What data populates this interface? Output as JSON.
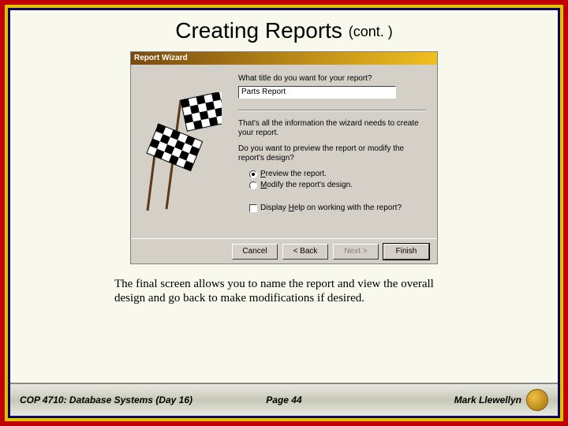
{
  "slide": {
    "title_main": "Creating Reports",
    "title_suffix": "(cont. )"
  },
  "wizard": {
    "titlebar": "Report Wizard",
    "q_title": "What title do you want for your report?",
    "title_value": "Parts Report",
    "info1": "That's all the information the wizard needs to create your report.",
    "q_preview": "Do you want to preview the report or modify the report's design?",
    "opt_preview_pre": "P",
    "opt_preview_post": "review the report.",
    "opt_modify_pre": "",
    "opt_modify_u": "M",
    "opt_modify_post": "odify the report's design.",
    "help_pre": "Display ",
    "help_u": "H",
    "help_post": "elp on working with the report?",
    "buttons": {
      "cancel": "Cancel",
      "back": "< Back",
      "next": "Next >",
      "finish": "Finish"
    }
  },
  "caption": "The final screen allows you to name the report and view the overall design and go back to make modifications if desired.",
  "footer": {
    "course": "COP 4710: Database Systems  (Day 16)",
    "page": "Page 44",
    "author": "Mark Llewellyn"
  }
}
